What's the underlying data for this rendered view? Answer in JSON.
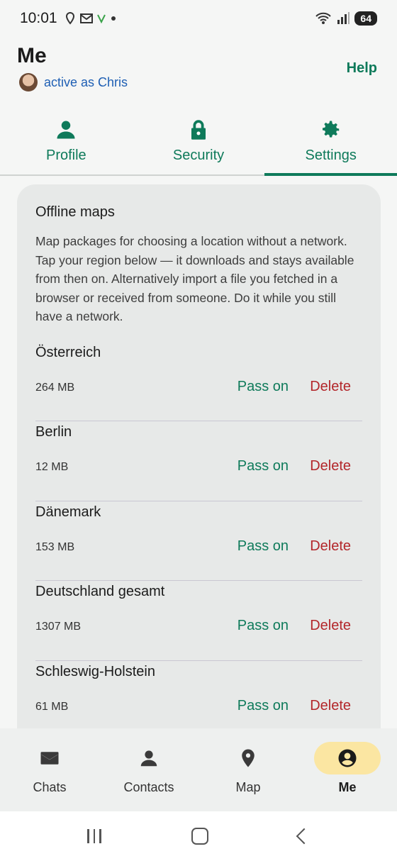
{
  "status_bar": {
    "time": "10:01",
    "battery": "64"
  },
  "header": {
    "title": "Me",
    "active_as": "active as Chris",
    "help": "Help"
  },
  "tabs": [
    {
      "label": "Profile",
      "icon": "person-icon"
    },
    {
      "label": "Security",
      "icon": "lock-icon"
    },
    {
      "label": "Settings",
      "icon": "gear-icon",
      "active": true
    }
  ],
  "offline_maps": {
    "title": "Offline maps",
    "description": "Map packages for choosing a location without a network. Tap your region below — it downloads and stays available from then on. Alternatively import a file you fetched in a browser or received from someone. Do it while you still have a network.",
    "pass_on_label": "Pass on",
    "delete_label": "Delete",
    "items": [
      {
        "name": "Österreich",
        "size": "264 MB"
      },
      {
        "name": "Berlin",
        "size": "12 MB"
      },
      {
        "name": "Dänemark",
        "size": "153 MB"
      },
      {
        "name": "Deutschland gesamt",
        "size": "1307 MB"
      },
      {
        "name": "Schleswig-Holstein",
        "size": "61 MB"
      }
    ]
  },
  "bottom_nav": [
    {
      "label": "Chats",
      "icon": "mail-icon"
    },
    {
      "label": "Contacts",
      "icon": "person-icon"
    },
    {
      "label": "Map",
      "icon": "map-pin-icon"
    },
    {
      "label": "Me",
      "icon": "account-circle-icon",
      "active": true
    }
  ],
  "colors": {
    "accent": "#0e7a5a",
    "danger": "#b3262a",
    "link": "#1e5fb4",
    "nav_active_bg": "#fbe6a2"
  }
}
